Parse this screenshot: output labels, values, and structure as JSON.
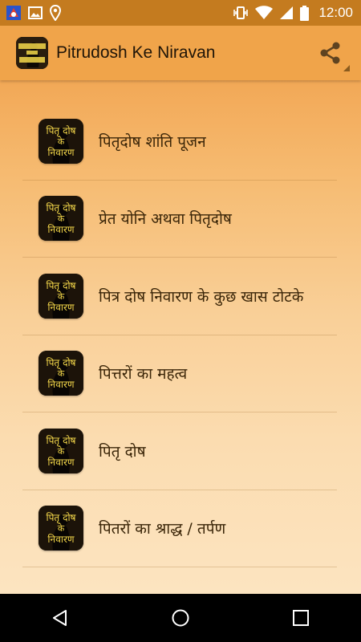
{
  "status_bar": {
    "time": "12:00",
    "left_icons": [
      "app-notification-icon",
      "image-icon",
      "location-icon"
    ],
    "right_icons": [
      "vibrate-icon",
      "wifi-icon",
      "cellular-signal-icon",
      "battery-icon"
    ]
  },
  "app_bar": {
    "title": "Pitrudosh Ke Niravan",
    "app_icon": "app-logo-icon",
    "action_icon": "share-icon"
  },
  "list": {
    "items": [
      {
        "label": "पितृदोष शांति पूजन"
      },
      {
        "label": "प्रेत योनि अथवा पितृदोष"
      },
      {
        "label": "पित्र दोष निवारण के कुछ खास टोटके"
      },
      {
        "label": "पित्तरों का महत्व"
      },
      {
        "label": "पितृ दोष"
      },
      {
        "label": "पितरों का श्राद्ध / तर्पण"
      }
    ]
  },
  "thumbnail": {
    "line1": "पितृ दोष",
    "line2": "के",
    "line3": "निवारण"
  },
  "nav_bar": {
    "buttons": [
      "back-icon",
      "home-icon",
      "recents-icon"
    ]
  },
  "colors": {
    "status_bar": "#c47b1f",
    "app_bar": "#f0a44a",
    "text": "#3a2508",
    "thumb_text": "#f5d84a"
  }
}
